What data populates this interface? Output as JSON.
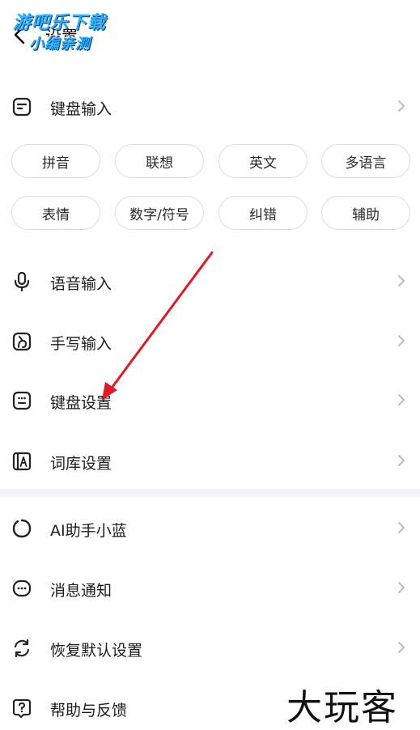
{
  "header": {
    "title": "设置",
    "watermark_line1": "游吧乐下载",
    "watermark_line2": "小编亲测"
  },
  "keyboard_input": {
    "label": "键盘输入",
    "icon": "keyboard-input-icon"
  },
  "chips": [
    {
      "label": "拼音"
    },
    {
      "label": "联想"
    },
    {
      "label": "英文"
    },
    {
      "label": "多语言"
    },
    {
      "label": "表情"
    },
    {
      "label": "数字/符号"
    },
    {
      "label": "纠错"
    },
    {
      "label": "辅助"
    }
  ],
  "menu": [
    {
      "label": "语音输入",
      "icon": "microphone-icon"
    },
    {
      "label": "手写输入",
      "icon": "handwriting-icon"
    },
    {
      "label": "键盘设置",
      "icon": "keyboard-settings-icon"
    },
    {
      "label": "词库设置",
      "icon": "dictionary-icon"
    },
    {
      "label": "AI助手小蓝",
      "icon": "ai-assistant-icon"
    },
    {
      "label": "消息通知",
      "icon": "message-icon"
    },
    {
      "label": "恢复默认设置",
      "icon": "reset-icon"
    },
    {
      "label": "帮助与反馈",
      "icon": "help-icon"
    }
  ],
  "brand": "大玩客",
  "colors": {
    "annotation_arrow": "#e01b24",
    "icon": "#222222",
    "chevron": "#b8bcc4",
    "chip_border": "#d9dce3"
  }
}
